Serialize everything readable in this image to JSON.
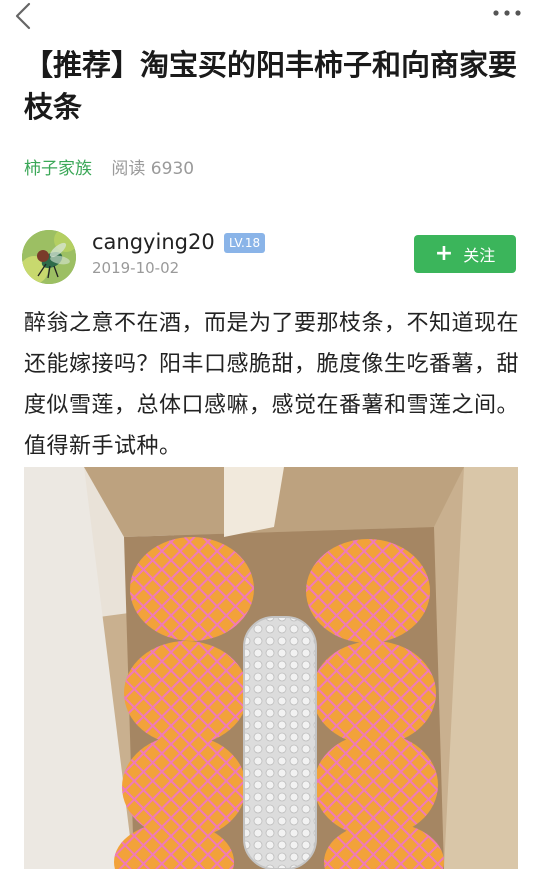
{
  "post": {
    "title": "【推荐】淘宝买的阳丰柿子和向商家要枝条",
    "category": "柿子家族",
    "reads": "阅读 6930",
    "body": "醉翁之意不在酒，而是为了要那枝条，不知道现在还能嫁接吗？阳丰口感脆甜，脆度像生吃番薯，甜度似雪莲，总体口感嘛，感觉在番薯和雪莲之间。值得新手试种。"
  },
  "author": {
    "username": "cangying20",
    "level": "LV.18",
    "date": "2019-10-02",
    "avatar_icon": "fly-avatar-icon"
  },
  "actions": {
    "follow_label": "关注",
    "follow_color": "#3bb55b"
  },
  "image": {
    "content_icon": "persimmons-in-box-photo"
  }
}
